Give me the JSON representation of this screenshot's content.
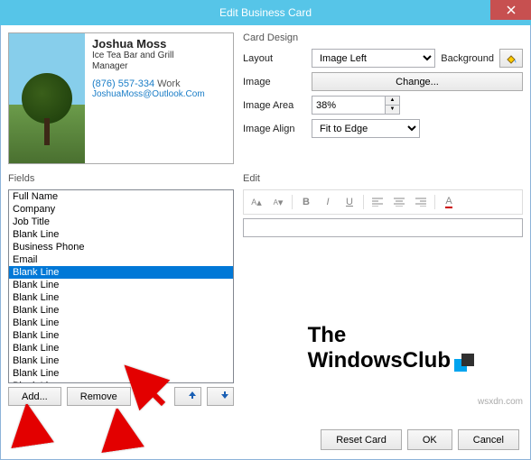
{
  "title": "Edit Business Card",
  "card": {
    "name": "Joshua Moss",
    "company": "Ice Tea Bar and Grill",
    "jobtitle": "Manager",
    "phone": "(876) 557-334",
    "phonelabel": "Work",
    "email": "JoshuaMoss@Outlook.Com"
  },
  "design": {
    "section": "Card Design",
    "layout_lbl": "Layout",
    "layout_val": "Image Left",
    "bg_lbl": "Background",
    "image_lbl": "Image",
    "change_btn": "Change...",
    "area_lbl": "Image Area",
    "area_val": "38%",
    "align_lbl": "Image Align",
    "align_val": "Fit to Edge"
  },
  "fields": {
    "section": "Fields",
    "items": [
      "Full Name",
      "Company",
      "Job Title",
      "Blank Line",
      "Business Phone",
      "Email",
      "Blank Line",
      "Blank Line",
      "Blank Line",
      "Blank Line",
      "Blank Line",
      "Blank Line",
      "Blank Line",
      "Blank Line",
      "Blank Line",
      "Blank Line"
    ],
    "selected_index": 6,
    "add_btn": "Add...",
    "remove_btn": "Remove"
  },
  "edit": {
    "section": "Edit"
  },
  "buttons": {
    "reset": "Reset Card",
    "ok": "OK",
    "cancel": "Cancel"
  },
  "logo": {
    "line1": "The",
    "line2": "WindowsClub"
  },
  "watermark": "wsxdn.com"
}
